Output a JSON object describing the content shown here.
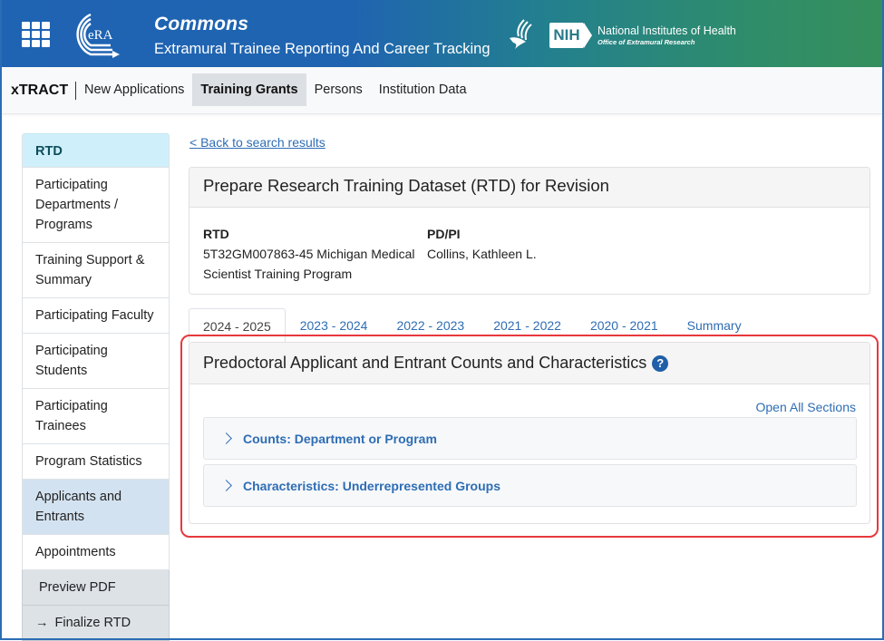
{
  "header": {
    "apps_icon": "apps-grid-icon",
    "logo": "eRA",
    "title": "Commons",
    "subtitle": "Extramural Trainee Reporting And Career Tracking",
    "hhs_logo": "hhs-eagle-icon",
    "nih_badge": "NIH",
    "nih_name": "National Institutes of Health",
    "nih_office": "Office of Extramural Research",
    "gradient_start": "#1f63b3",
    "gradient_end": "#358f5c"
  },
  "nav": {
    "brand": "xTRACT",
    "items": [
      {
        "label": "New Applications",
        "active": false
      },
      {
        "label": "Training Grants",
        "active": true
      },
      {
        "label": "Persons",
        "active": false
      },
      {
        "label": "Institution Data",
        "active": false
      }
    ]
  },
  "sidebar": {
    "header": "RTD",
    "items": [
      {
        "label": "Participating Departments / Programs"
      },
      {
        "label": "Training Support & Summary"
      },
      {
        "label": "Participating Faculty"
      },
      {
        "label": "Participating Students"
      },
      {
        "label": "Participating Trainees"
      },
      {
        "label": "Program Statistics"
      },
      {
        "label": "Applicants and Entrants",
        "selected": true
      },
      {
        "label": "Appointments"
      }
    ],
    "actions": {
      "preview": "Preview PDF",
      "finalize_arrow": "→",
      "finalize": "Finalize RTD"
    }
  },
  "main": {
    "back_link": "< Back to search results",
    "info_card": {
      "title": "Prepare Research Training Dataset (RTD) for Revision",
      "rtd_label": "RTD",
      "rtd_value": "5T32GM007863-45 Michigan Medical Scientist Training Program",
      "pdpi_label": "PD/PI",
      "pdpi_value": "Collins, Kathleen L."
    },
    "tabs": [
      {
        "label": "2024 - 2025",
        "active": true
      },
      {
        "label": "2023 - 2024"
      },
      {
        "label": "2022 - 2023"
      },
      {
        "label": "2021 - 2022"
      },
      {
        "label": "2020 - 2021"
      },
      {
        "label": "Summary"
      }
    ],
    "section": {
      "title": "Predoctoral Applicant and Entrant Counts and Characteristics",
      "help_glyph": "?",
      "open_all": "Open All Sections",
      "accordions": [
        {
          "label": "Counts: Department or Program",
          "expanded": false
        },
        {
          "label": "Characteristics: Underrepresented Groups",
          "expanded": false
        }
      ]
    },
    "highlight_color": "#e8383d"
  }
}
